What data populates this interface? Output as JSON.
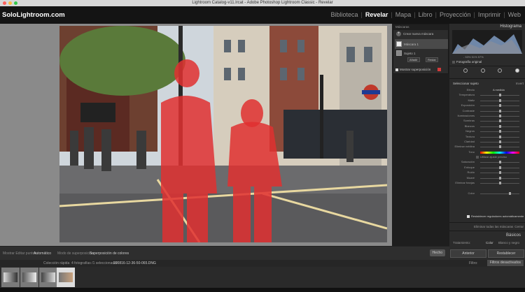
{
  "window": {
    "title": "Lightroom Catalog-v11.lrcat - Adobe Photoshop Lightroom Classic - Revelar"
  },
  "brand": "SoloLightroom.com",
  "modules": [
    {
      "label": "Biblioteca",
      "active": false
    },
    {
      "label": "Revelar",
      "active": true
    },
    {
      "label": "Mapa",
      "active": false
    },
    {
      "label": "Libro",
      "active": false
    },
    {
      "label": "Proyección",
      "active": false
    },
    {
      "label": "Imprimir",
      "active": false
    },
    {
      "label": "Web",
      "active": false
    }
  ],
  "mask_panel": {
    "header": "Máscaras",
    "create_new": "Crear nueva máscara",
    "mask_name": "Máscara 1",
    "subject_name": "Sujeto 1",
    "add_button": "Añadir",
    "subtract_button": "Restar",
    "show_overlay": "Mostrar superposición",
    "overlay_color": "#d23a3a"
  },
  "right_panel": {
    "histogram_title": "Histograma",
    "histogram_stats": [
      "-",
      "53",
      "%",
      "51",
      "%",
      "57",
      "%"
    ],
    "original_photo": "Fotografía original",
    "select_subject": "Seleccionar sujeto",
    "select_subject_right": "Invert",
    "sliders": [
      {
        "label": "Efecto",
        "value": "A medida"
      },
      {
        "label": "Temperatura",
        "pos": 0.5
      },
      {
        "label": "Matiz",
        "pos": 0.5
      },
      {
        "label": "Exposición",
        "pos": 0.5
      },
      {
        "label": "Contraste",
        "pos": 0.5
      },
      {
        "label": "Iluminaciones",
        "pos": 0.5
      },
      {
        "label": "Sombras",
        "pos": 0.5
      },
      {
        "label": "Blancos",
        "pos": 0.5
      },
      {
        "label": "Negros",
        "pos": 0.5
      },
      {
        "label": "Textura",
        "pos": 0.5
      },
      {
        "label": "Claridad",
        "pos": 0.5
      },
      {
        "label": "Eliminar neblina",
        "pos": 0.5
      },
      {
        "label": "Tono",
        "hue": true
      },
      {
        "label": "",
        "check": "Utilizar ajuste preciso"
      },
      {
        "label": "Saturación",
        "pos": 0.5
      },
      {
        "label": "Enfoque",
        "pos": 0.5
      },
      {
        "label": "Ruido",
        "pos": 0.5
      },
      {
        "label": "Muaré",
        "pos": 0.5
      },
      {
        "label": "Eliminar franjas",
        "pos": 0.5
      },
      {
        "label": "",
        "pos": null
      },
      {
        "label": "Color",
        "pos": 0.75
      }
    ],
    "reset_auto": "Restablecer reguladores automáticamente",
    "remove_all": "Eliminar todas las máscaras",
    "close": "Cerrar",
    "basic_title": "Básicos",
    "treatment_label": "Tratamiento:",
    "treatment_color": "Color",
    "treatment_bw": "Blanco y negro"
  },
  "bottom_buttons": {
    "previous": "Anterior",
    "reset": "Restablecer"
  },
  "toolbar": {
    "show_edit_pins_label": "Mostrar Editar puntos:",
    "show_edit_pins_value": "Automático",
    "overlay_mode_label": "Modo de superposición:",
    "overlay_mode_value": "Superposición de colores",
    "done": "Hecho"
  },
  "filmstrip_header": {
    "source": "Colección rápida",
    "count": "4 fotografías /1 seleccionada/",
    "filename": "200816-12-36-50-065.DNG",
    "filter_label": "Filtro:",
    "filter_value": "Filtros desactivados"
  },
  "thumbnails": [
    {
      "colors": [
        "#dcdcdc",
        "#333"
      ]
    },
    {
      "colors": [
        "#555",
        "#eee"
      ]
    },
    {
      "colors": [
        "#444",
        "#ddd"
      ]
    },
    {
      "colors": [
        "#777",
        "#c9a27e"
      ]
    }
  ],
  "colors": {
    "accent_red": "#d23a3a",
    "panel_bg": "#2b2b2b",
    "canvas_bg": "#8a8a8a"
  }
}
